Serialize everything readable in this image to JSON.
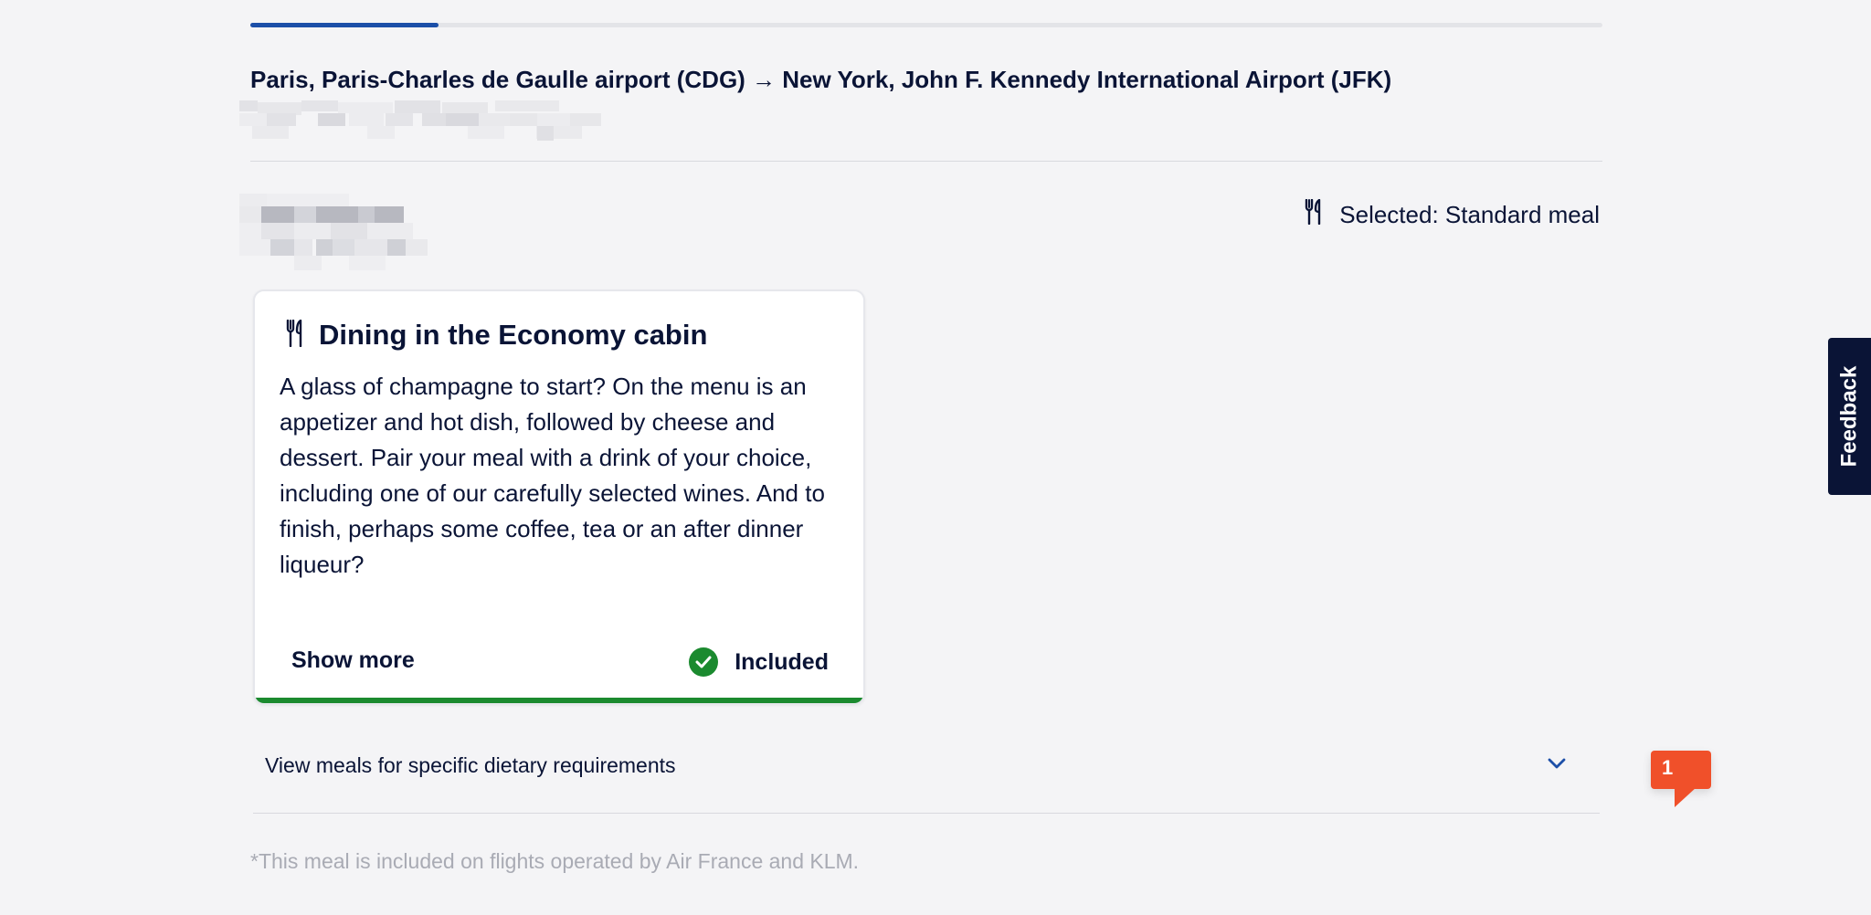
{
  "progress": {
    "value": 0.139
  },
  "route": {
    "title": "Paris, Paris-Charles de Gaulle airport (CDG) → New York, John F. Kennedy International Airport (JFK)"
  },
  "meal_selection": {
    "selected_label": "Selected: Standard meal",
    "icon": "cutlery-icon"
  },
  "card": {
    "icon": "cutlery-icon",
    "title": "Dining in the Economy cabin",
    "description": "A glass of champagne to start? On the menu is an appetizer and hot dish, followed by cheese and dessert. Pair your meal with a drink of your choice, including one of our carefully selected wines. And to finish, perhaps some coffee, tea or an after dinner liqueur?",
    "show_more_label": "Show more",
    "included_label": "Included",
    "included_icon": "check-circle-icon"
  },
  "dietary": {
    "label": "View meals for specific dietary requirements",
    "icon": "chevron-down-icon"
  },
  "footnote": "*This meal is included on flights operated by Air France and KLM.",
  "feedback": {
    "label": "Feedback"
  },
  "notification": {
    "count": "1"
  },
  "colors": {
    "brand_navy": "#0a1436",
    "progress_blue": "#1c4fa8",
    "included_green": "#1b8a2f",
    "notification_orange": "#f0502a",
    "background": "#f4f4f6"
  }
}
